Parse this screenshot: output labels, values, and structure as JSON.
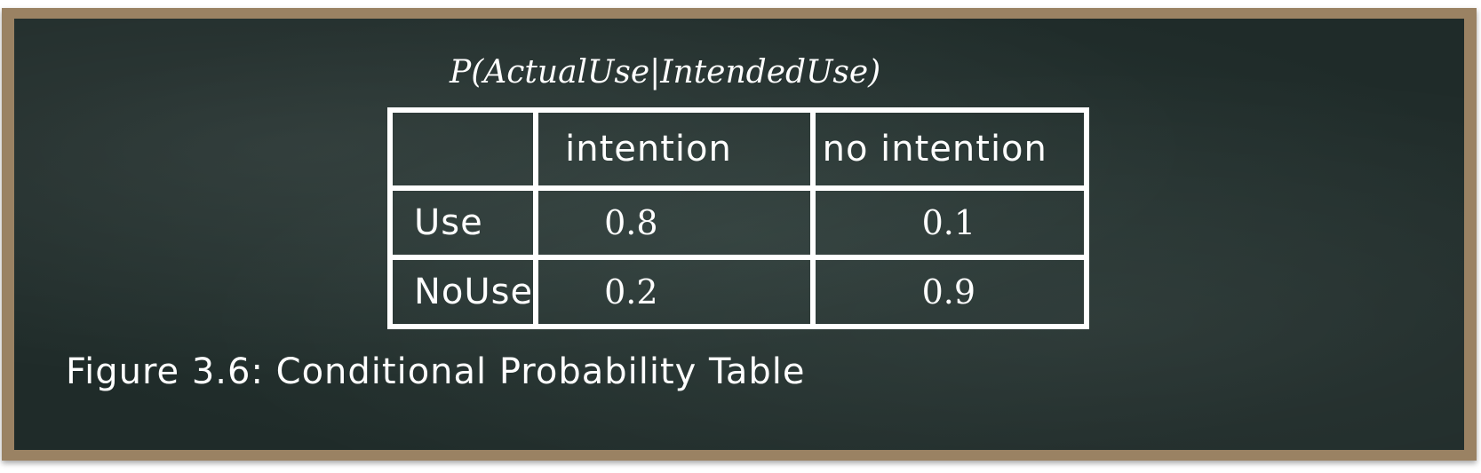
{
  "table_title": "P(ActualUse|IntendedUse)",
  "table": {
    "column_headers": [
      "",
      "intention",
      "no intention"
    ],
    "rows": [
      {
        "label": "Use",
        "values": [
          "0.8",
          "0.1"
        ]
      },
      {
        "label": "NoUse",
        "values": [
          "0.2",
          "0.9"
        ]
      }
    ]
  },
  "caption": "Figure 3.6: Conditional Probability Table"
}
